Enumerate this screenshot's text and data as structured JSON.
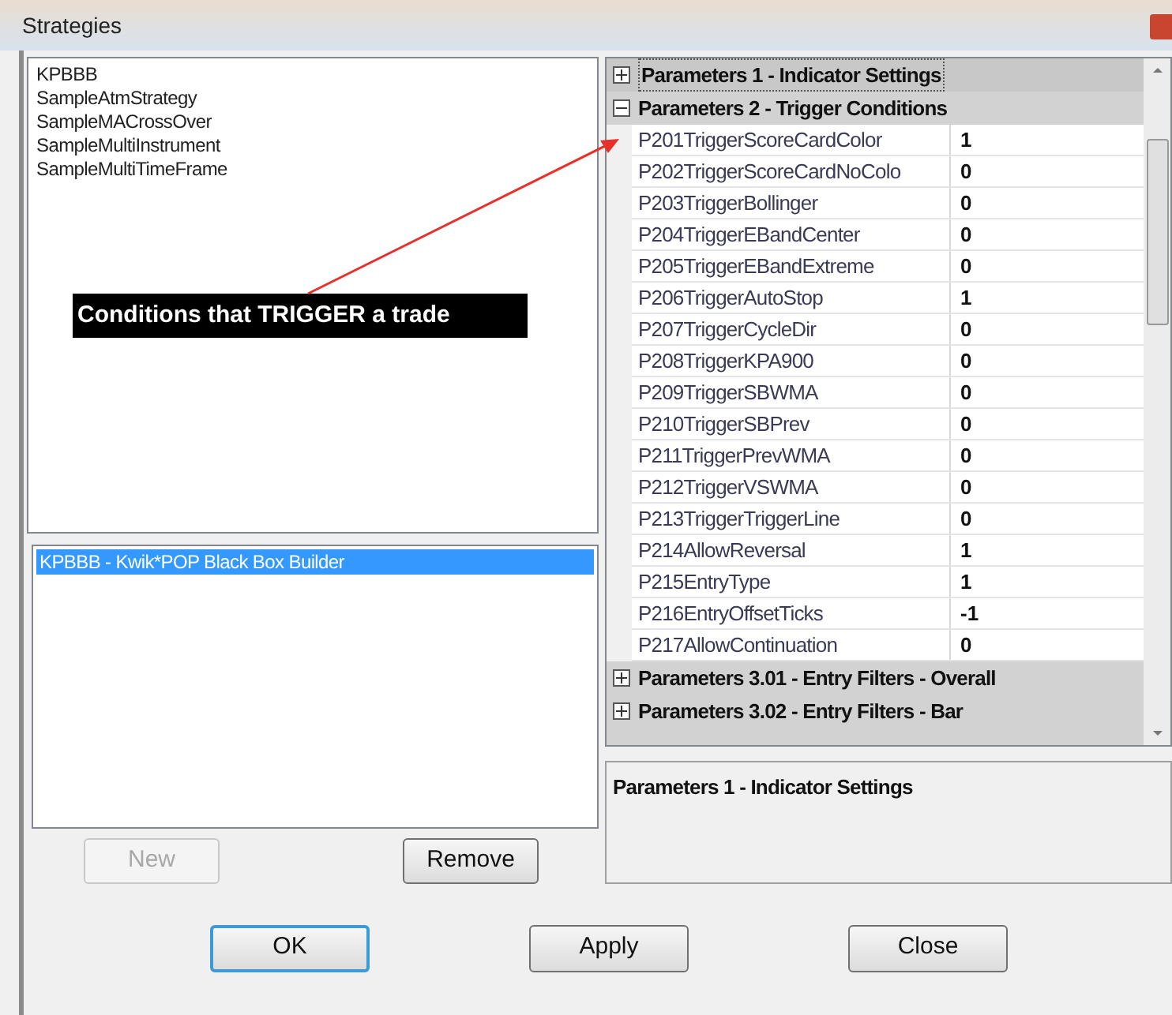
{
  "window": {
    "title": "Strategies"
  },
  "strategies": [
    {
      "label": "KPBBB",
      "selected": false
    },
    {
      "label": "SampleAtmStrategy",
      "selected": false
    },
    {
      "label": "SampleMACrossOver",
      "selected": false
    },
    {
      "label": "SampleMultiInstrument",
      "selected": false
    },
    {
      "label": "SampleMultiTimeFrame",
      "selected": false
    }
  ],
  "annotation": {
    "text": "Conditions that TRIGGER a trade"
  },
  "loaded_strategies": [
    {
      "label": "KPBBB - Kwik*POP Black Box Builder",
      "selected": true
    }
  ],
  "list_buttons": [
    {
      "label": "New",
      "disabled": true
    },
    {
      "label": "Remove",
      "disabled": false
    }
  ],
  "property_grid": {
    "categories": [
      {
        "title": "Parameters 1 - Indicator Settings",
        "expanded": false,
        "selected": true
      },
      {
        "title": "Parameters 2 - Trigger Conditions",
        "expanded": true,
        "selected": false,
        "properties": [
          {
            "name": "P201TriggerScoreCardColor",
            "value": "1"
          },
          {
            "name": "P202TriggerScoreCardNoColo",
            "value": "0"
          },
          {
            "name": "P203TriggerBollinger",
            "value": "0"
          },
          {
            "name": "P204TriggerEBandCenter",
            "value": "0"
          },
          {
            "name": "P205TriggerEBandExtreme",
            "value": "0"
          },
          {
            "name": "P206TriggerAutoStop",
            "value": "1"
          },
          {
            "name": "P207TriggerCycleDir",
            "value": "0"
          },
          {
            "name": "P208TriggerKPA900",
            "value": "0"
          },
          {
            "name": "P209TriggerSBWMA",
            "value": "0"
          },
          {
            "name": "P210TriggerSBPrev",
            "value": "0"
          },
          {
            "name": "P211TriggerPrevWMA",
            "value": "0"
          },
          {
            "name": "P212TriggerVSWMA",
            "value": "0"
          },
          {
            "name": "P213TriggerTriggerLine",
            "value": "0"
          },
          {
            "name": "P214AllowReversal",
            "value": "1"
          },
          {
            "name": "P215EntryType",
            "value": "1"
          },
          {
            "name": "P216EntryOffsetTicks",
            "value": "-1"
          },
          {
            "name": "P217AllowContinuation",
            "value": "0"
          }
        ]
      },
      {
        "title": "Parameters 3.01 - Entry Filters - Overall",
        "expanded": false,
        "selected": false
      },
      {
        "title": "Parameters 3.02 - Entry Filters - Bar",
        "expanded": false,
        "selected": false
      }
    ]
  },
  "description": {
    "title": "Parameters 1 - Indicator Settings"
  },
  "dialog_buttons": [
    {
      "label": "OK",
      "focused": true
    },
    {
      "label": "Apply",
      "focused": false
    },
    {
      "label": "Close",
      "focused": false
    }
  ]
}
